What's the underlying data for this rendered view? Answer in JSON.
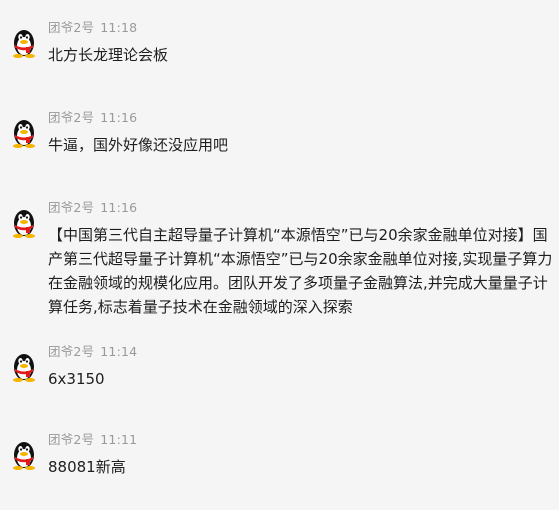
{
  "messages": [
    {
      "sender": "团爷2号",
      "time": "11:18",
      "text": "北方长龙理论会板"
    },
    {
      "sender": "团爷2号",
      "time": "11:16",
      "text": "牛逼，国外好像还没应用吧"
    },
    {
      "sender": "团爷2号",
      "time": "11:16",
      "text": "【中国第三代自主超导量子计算机“本源悟空”已与20余家金融单位对接】国产第三代超导量子计算机“本源悟空”已与20余家金融单位对接,实现量子算力在金融领域的规模化应用。团队开发了多项量子金融算法,并完成大量量子计算任务,标志着量子技术在金融领域的深入探索"
    },
    {
      "sender": "团爷2号",
      "time": "11:14",
      "text": "6x3150"
    },
    {
      "sender": "团爷2号",
      "time": "11:11",
      "text": "88081新高"
    }
  ],
  "avatar_icon": "qq-penguin-icon"
}
